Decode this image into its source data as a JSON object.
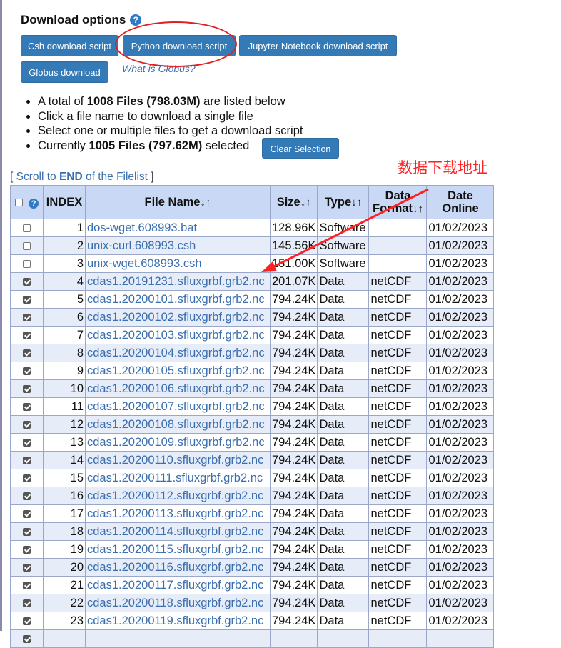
{
  "header": {
    "title": "Download options",
    "help_icon": "?"
  },
  "buttons": {
    "csh": "Csh download script",
    "python": "Python download script",
    "jupyter": "Jupyter Notebook download script",
    "globus": "Globus download",
    "globus_link": "What is Globus?",
    "clear": "Clear Selection"
  },
  "info": {
    "line1_pre": "A total of ",
    "line1_bold": "1008 Files (798.03M)",
    "line1_post": " are listed below",
    "line2": "Click a file name to download a single file",
    "line3": "Select one or multiple files to get a download script",
    "line4_pre": "Currently ",
    "line4_bold": "1005 Files (797.62M)",
    "line4_post": " selected"
  },
  "scroll": {
    "open": "[ ",
    "pre": "Scroll to ",
    "bold": "END",
    "post": " of the Filelist",
    "close": " ]"
  },
  "annotation": "数据下载地址",
  "table": {
    "headers": {
      "index": "INDEX",
      "filename": "File Name",
      "size": "Size",
      "type": "Type",
      "format_1": "Data",
      "format_2": "Format",
      "date_1": "Date",
      "date_2": "Online",
      "sort": "↓↑"
    },
    "rows": [
      {
        "checked": false,
        "index": "1",
        "name": "dos-wget.608993.bat",
        "size": "128.96K",
        "type": "Software",
        "format": "",
        "date": "01/02/2023"
      },
      {
        "checked": false,
        "index": "2",
        "name": "unix-curl.608993.csh",
        "size": "145.56K",
        "type": "Software",
        "format": "",
        "date": "01/02/2023"
      },
      {
        "checked": false,
        "index": "3",
        "name": "unix-wget.608993.csh",
        "size": "151.00K",
        "type": "Software",
        "format": "",
        "date": "01/02/2023"
      },
      {
        "checked": true,
        "index": "4",
        "name": "cdas1.20191231.sfluxgrbf.grb2.nc",
        "size": "201.07K",
        "type": "Data",
        "format": "netCDF",
        "date": "01/02/2023"
      },
      {
        "checked": true,
        "index": "5",
        "name": "cdas1.20200101.sfluxgrbf.grb2.nc",
        "size": "794.24K",
        "type": "Data",
        "format": "netCDF",
        "date": "01/02/2023"
      },
      {
        "checked": true,
        "index": "6",
        "name": "cdas1.20200102.sfluxgrbf.grb2.nc",
        "size": "794.24K",
        "type": "Data",
        "format": "netCDF",
        "date": "01/02/2023"
      },
      {
        "checked": true,
        "index": "7",
        "name": "cdas1.20200103.sfluxgrbf.grb2.nc",
        "size": "794.24K",
        "type": "Data",
        "format": "netCDF",
        "date": "01/02/2023"
      },
      {
        "checked": true,
        "index": "8",
        "name": "cdas1.20200104.sfluxgrbf.grb2.nc",
        "size": "794.24K",
        "type": "Data",
        "format": "netCDF",
        "date": "01/02/2023"
      },
      {
        "checked": true,
        "index": "9",
        "name": "cdas1.20200105.sfluxgrbf.grb2.nc",
        "size": "794.24K",
        "type": "Data",
        "format": "netCDF",
        "date": "01/02/2023"
      },
      {
        "checked": true,
        "index": "10",
        "name": "cdas1.20200106.sfluxgrbf.grb2.nc",
        "size": "794.24K",
        "type": "Data",
        "format": "netCDF",
        "date": "01/02/2023"
      },
      {
        "checked": true,
        "index": "11",
        "name": "cdas1.20200107.sfluxgrbf.grb2.nc",
        "size": "794.24K",
        "type": "Data",
        "format": "netCDF",
        "date": "01/02/2023"
      },
      {
        "checked": true,
        "index": "12",
        "name": "cdas1.20200108.sfluxgrbf.grb2.nc",
        "size": "794.24K",
        "type": "Data",
        "format": "netCDF",
        "date": "01/02/2023"
      },
      {
        "checked": true,
        "index": "13",
        "name": "cdas1.20200109.sfluxgrbf.grb2.nc",
        "size": "794.24K",
        "type": "Data",
        "format": "netCDF",
        "date": "01/02/2023"
      },
      {
        "checked": true,
        "index": "14",
        "name": "cdas1.20200110.sfluxgrbf.grb2.nc",
        "size": "794.24K",
        "type": "Data",
        "format": "netCDF",
        "date": "01/02/2023"
      },
      {
        "checked": true,
        "index": "15",
        "name": "cdas1.20200111.sfluxgrbf.grb2.nc",
        "size": "794.24K",
        "type": "Data",
        "format": "netCDF",
        "date": "01/02/2023"
      },
      {
        "checked": true,
        "index": "16",
        "name": "cdas1.20200112.sfluxgrbf.grb2.nc",
        "size": "794.24K",
        "type": "Data",
        "format": "netCDF",
        "date": "01/02/2023"
      },
      {
        "checked": true,
        "index": "17",
        "name": "cdas1.20200113.sfluxgrbf.grb2.nc",
        "size": "794.24K",
        "type": "Data",
        "format": "netCDF",
        "date": "01/02/2023"
      },
      {
        "checked": true,
        "index": "18",
        "name": "cdas1.20200114.sfluxgrbf.grb2.nc",
        "size": "794.24K",
        "type": "Data",
        "format": "netCDF",
        "date": "01/02/2023"
      },
      {
        "checked": true,
        "index": "19",
        "name": "cdas1.20200115.sfluxgrbf.grb2.nc",
        "size": "794.24K",
        "type": "Data",
        "format": "netCDF",
        "date": "01/02/2023"
      },
      {
        "checked": true,
        "index": "20",
        "name": "cdas1.20200116.sfluxgrbf.grb2.nc",
        "size": "794.24K",
        "type": "Data",
        "format": "netCDF",
        "date": "01/02/2023"
      },
      {
        "checked": true,
        "index": "21",
        "name": "cdas1.20200117.sfluxgrbf.grb2.nc",
        "size": "794.24K",
        "type": "Data",
        "format": "netCDF",
        "date": "01/02/2023"
      },
      {
        "checked": true,
        "index": "22",
        "name": "cdas1.20200118.sfluxgrbf.grb2.nc",
        "size": "794.24K",
        "type": "Data",
        "format": "netCDF",
        "date": "01/02/2023"
      },
      {
        "checked": true,
        "index": "23",
        "name": "cdas1.20200119.sfluxgrbf.grb2.nc",
        "size": "794.24K",
        "type": "Data",
        "format": "netCDF",
        "date": "01/02/2023"
      },
      {
        "checked": true,
        "index": "",
        "name": "",
        "size": "",
        "type": "",
        "format": "",
        "date": ""
      }
    ]
  }
}
